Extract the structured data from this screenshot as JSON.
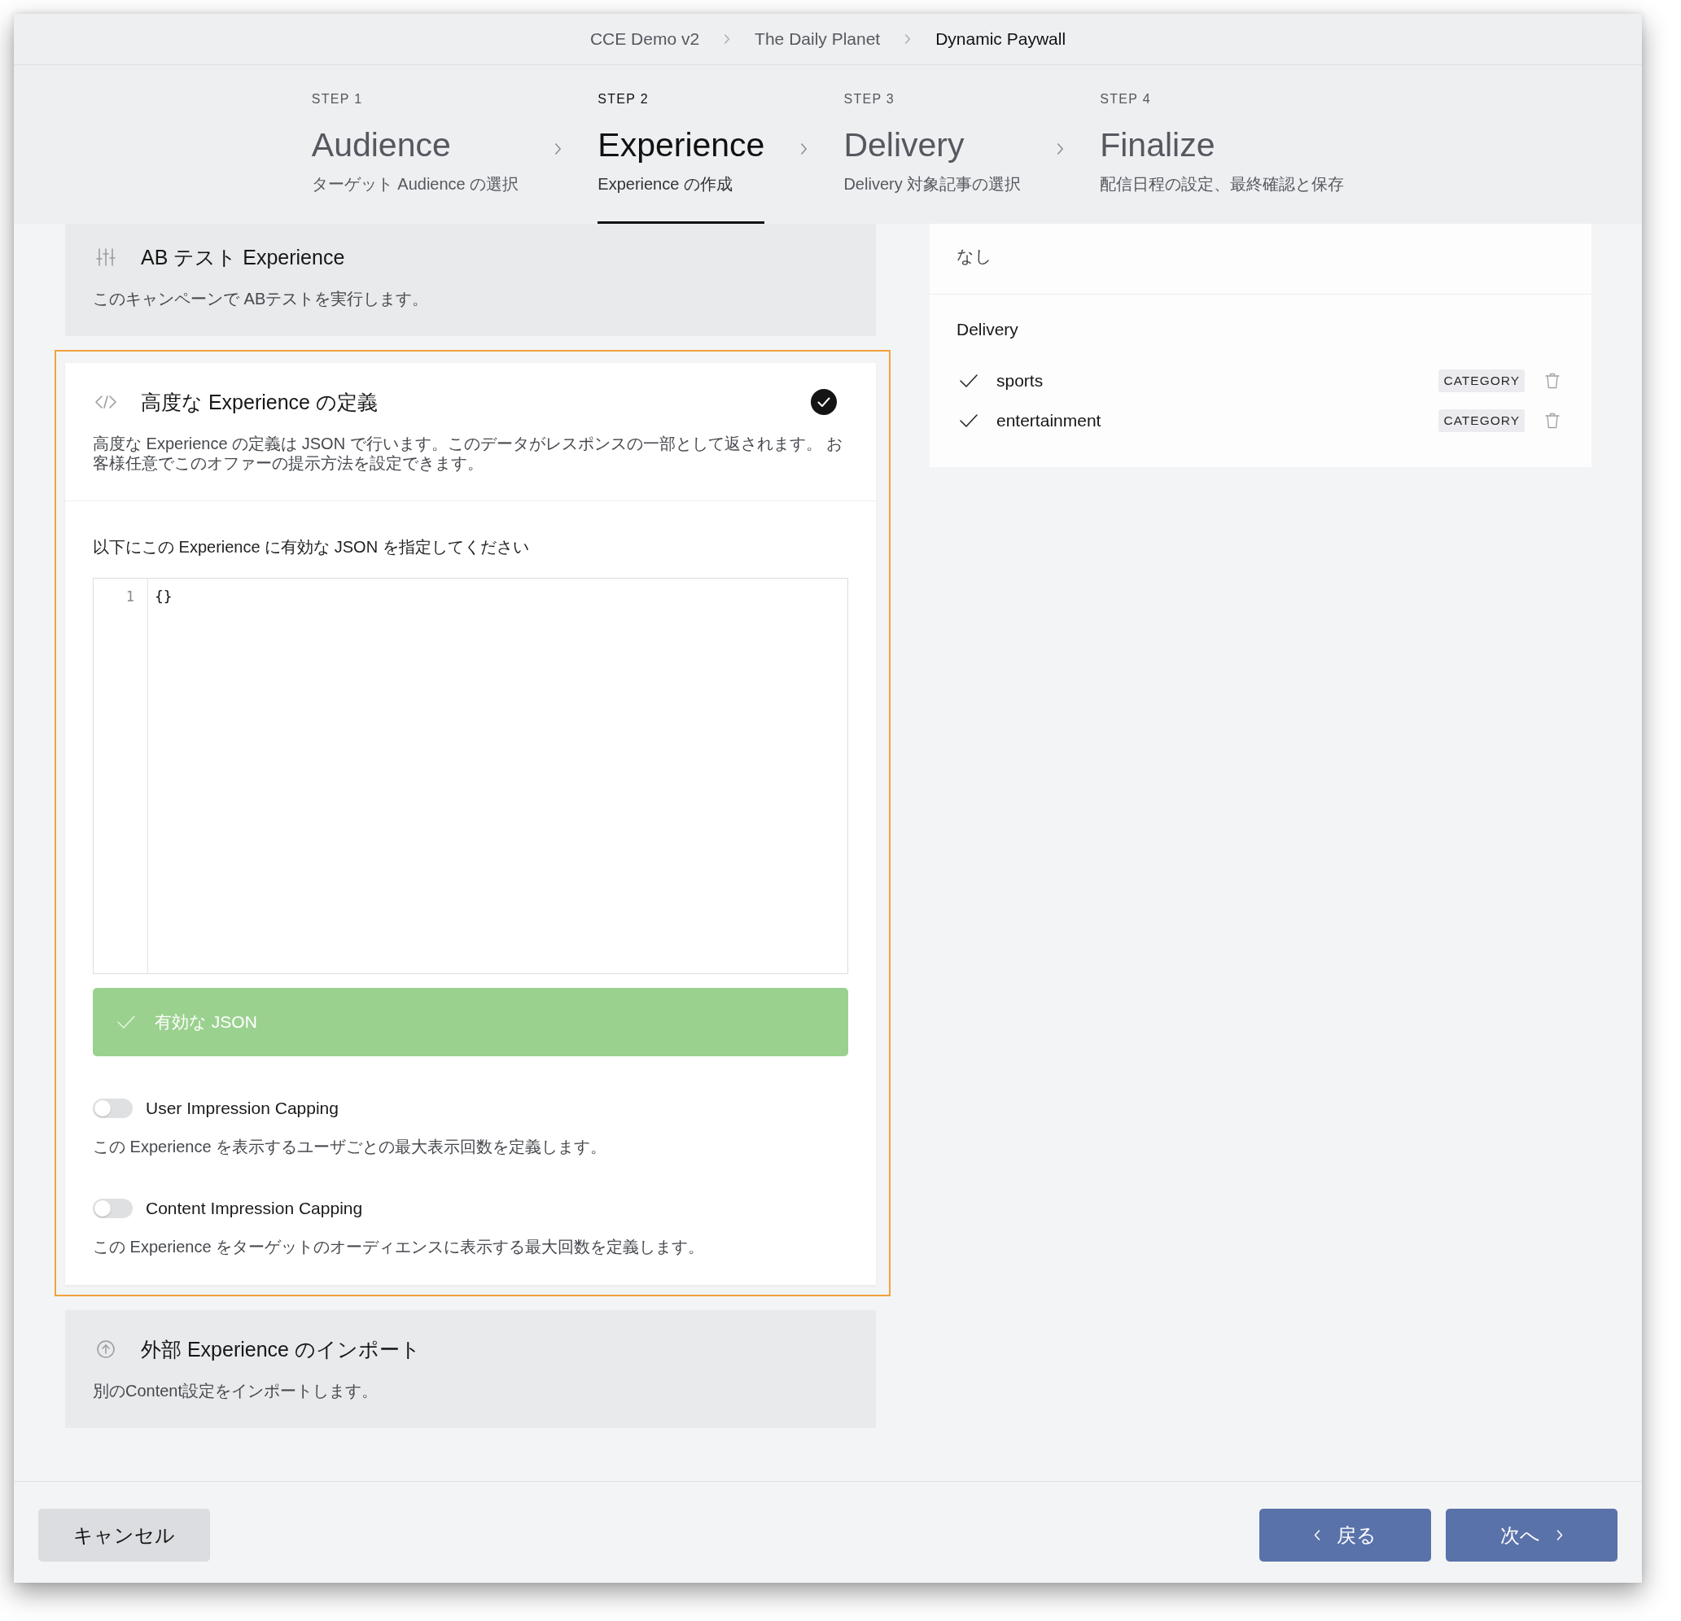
{
  "breadcrumb": [
    {
      "label": "CCE Demo v2",
      "current": false
    },
    {
      "label": "The Daily Planet",
      "current": false
    },
    {
      "label": "Dynamic Paywall",
      "current": true
    }
  ],
  "steps": [
    {
      "step": "STEP 1",
      "title": "Audience",
      "subtitle": "ターゲット Audience の選択",
      "selected": false
    },
    {
      "step": "STEP 2",
      "title": "Experience",
      "subtitle": "Experience の作成",
      "selected": true
    },
    {
      "step": "STEP 3",
      "title": "Delivery",
      "subtitle": "Delivery 対象記事の選択",
      "selected": false
    },
    {
      "step": "STEP 4",
      "title": "Finalize",
      "subtitle": "配信日程の設定、最終確認と保存",
      "selected": false
    }
  ],
  "experience_options": [
    {
      "kind": "ab_test",
      "title": "AB テスト Experience",
      "description": "このキャンペーンで ABテストを実行します。",
      "selected": false,
      "highlighted": false
    },
    {
      "kind": "json",
      "title": "高度な Experience の定義",
      "description": "高度な Experience の定義は JSON で行います。このデータがレスポンスの一部として返されます。 お客様任意でこのオファーの提示方法を設定できます。",
      "selected": true,
      "highlighted": true,
      "details": {
        "editor_label": "以下にこの Experience に有効な JSON を指定してください",
        "editor_lines": [
          {
            "number": "1",
            "code": "{}"
          }
        ],
        "validation": {
          "text": "有効な JSON",
          "valid": true
        },
        "toggles": [
          {
            "label": "User Impression Capping",
            "on": false,
            "description": "この Experience を表示するユーザごとの最大表示回数を定義します。"
          },
          {
            "label": "Content Impression Capping",
            "on": false,
            "description": "この Experience をターゲットのオーディエンスに表示する最大回数を定義します。"
          }
        ]
      }
    },
    {
      "kind": "import",
      "title": "外部 Experience のインポート",
      "description": "別のContent設定をインポートします。",
      "selected": false,
      "highlighted": false
    }
  ],
  "summary": {
    "capping_value": "なし",
    "delivery": {
      "title": "Delivery",
      "items": [
        {
          "name": "sports",
          "tag": "CATEGORY"
        },
        {
          "name": "entertainment",
          "tag": "CATEGORY"
        }
      ]
    }
  },
  "footer": {
    "cancel": "キャンセル",
    "back": "戻る",
    "next": "次へ"
  }
}
